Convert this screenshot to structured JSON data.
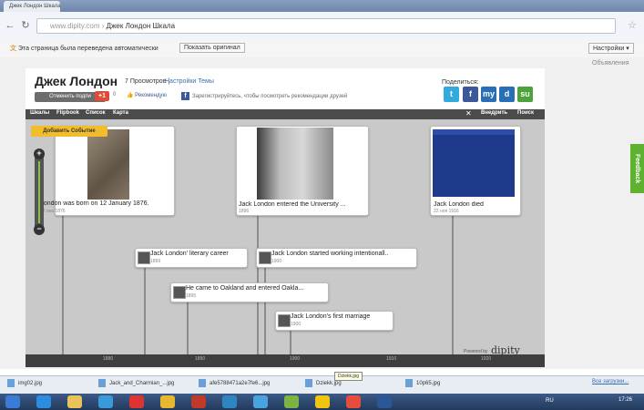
{
  "browser": {
    "tab_title": "Джек Лондон Шкала",
    "url_host": "www.dipity.com",
    "url_title": "Джек Лондон Шкала",
    "translate_message": "Эта страница была переведена автоматически",
    "show_original": "Показать оригинал",
    "translate_settings": "Настройки ▾"
  },
  "page": {
    "ads_label": "Объявления",
    "feedback": "Feedback"
  },
  "dipity_header": {
    "title": "Джек Лондон",
    "views": "7 Просмотров |",
    "settings_link": "Настройки Темы",
    "follow_button": "Отменить подпи",
    "gplus": "+1",
    "gplus_count": "0",
    "like": "Рекомендую",
    "fb_text": "Зарегистрируйтесь, чтобы посмотреть рекомендации друзей",
    "share_label": "Поделиться:",
    "share": [
      {
        "name": "twitter",
        "glyph": "t",
        "color": "#33aadd"
      },
      {
        "name": "facebook",
        "glyph": "f",
        "color": "#3b5998"
      },
      {
        "name": "myspace",
        "glyph": "my",
        "color": "#2a6fb6"
      },
      {
        "name": "delicious",
        "glyph": "d",
        "color": "#2a6fb6"
      },
      {
        "name": "stumbleupon",
        "glyph": "su",
        "color": "#4da33b"
      }
    ]
  },
  "timeline_nav": {
    "items": [
      "Шкалы",
      "Flipbook",
      "Список",
      "Карта"
    ],
    "embed": "Внедрить",
    "search": "Поиск"
  },
  "timeline": {
    "add_event": "Добавить Событие",
    "events_large": [
      {
        "title": "London was born on 12 January 1876.",
        "date": "12 янв 1876"
      },
      {
        "title": "Jack London entered the University ...",
        "date": "1896"
      },
      {
        "title": "Jack London died",
        "date": "22 ноя 1916"
      }
    ],
    "events_small": [
      {
        "title": "Jack London' literary career",
        "date": "1899"
      },
      {
        "title": "Jack London started working intentionall..",
        "date": "1900"
      },
      {
        "title": "He came to Oakland and entered Oakla...",
        "date": "1895"
      },
      {
        "title": "Jack London's first marriage",
        "date": "1900"
      }
    ],
    "ticks": [
      "1880",
      "1890",
      "1900",
      "1910",
      "1920"
    ],
    "powered_by": "Powered by",
    "brand": "dipity",
    "tooltip": "Dziekk.jpg"
  },
  "downloads": {
    "items": [
      "img02.jpg",
      "Jack_and_Charmian_...jpg",
      "afe5788471a2e7fe6...jpg",
      "Dziekk.jpg",
      "10p65.jpg"
    ],
    "show_all": "Все загрузки..."
  },
  "taskbar": {
    "lang": "RU",
    "clock": "17:26",
    "apps": [
      {
        "name": "start",
        "color": "#3a7bd5"
      },
      {
        "name": "ie",
        "color": "#2b8de0"
      },
      {
        "name": "explorer",
        "color": "#e7c35a"
      },
      {
        "name": "media",
        "color": "#3a9ad9"
      },
      {
        "name": "opera",
        "color": "#d33"
      },
      {
        "name": "chrome",
        "color": "#e8b730"
      },
      {
        "name": "app6",
        "color": "#c0392b"
      },
      {
        "name": "app7",
        "color": "#2e86c1"
      },
      {
        "name": "app8",
        "color": "#4aa3df"
      },
      {
        "name": "app9",
        "color": "#7db343"
      },
      {
        "name": "app10",
        "color": "#f1c40f"
      },
      {
        "name": "app11",
        "color": "#e74c3c"
      },
      {
        "name": "word",
        "color": "#2b5797"
      }
    ]
  }
}
